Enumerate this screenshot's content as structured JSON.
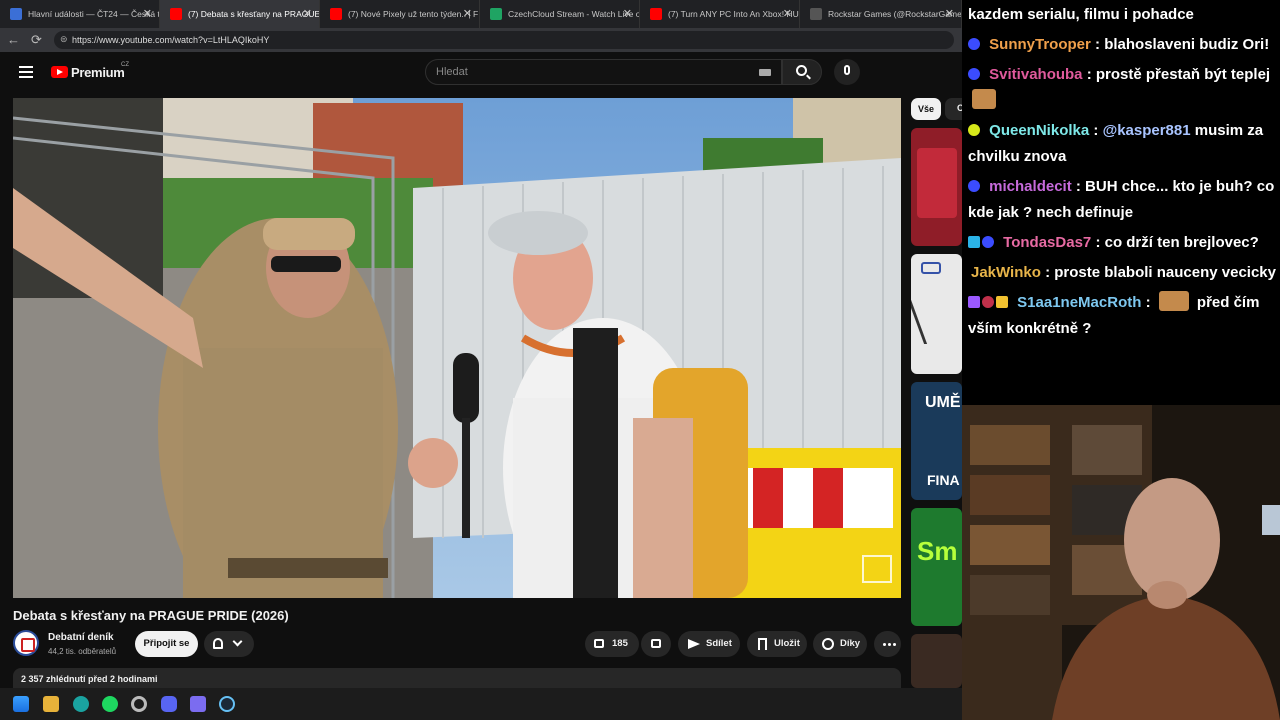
{
  "browser": {
    "tabs": [
      {
        "title": "Hlavní události — ČT24 — Česká t",
        "color": "#3b6fd6",
        "active": false
      },
      {
        "title": "(7) Debata s křesťany na PRAGUE",
        "color": "#ff0000",
        "active": true
      },
      {
        "title": "(7) Nové Pixely už tento týden.. | F",
        "color": "#ff0000",
        "active": false
      },
      {
        "title": "CzechCloud Stream - Watch Live o",
        "color": "#1fa463",
        "active": false
      },
      {
        "title": "(7) Turn ANY PC Into An Xbox! HU",
        "color": "#ff0000",
        "active": false
      },
      {
        "title": "Rockstar Games (@RockstarGame",
        "color": "#555555",
        "active": false
      }
    ],
    "url": "https://www.youtube.com/watch?v=LtHLAQIkoHY"
  },
  "youtube": {
    "logo_text": "Premium",
    "region": "CZ",
    "search_placeholder": "Hledat",
    "video_title": "Debata s křesťany na PRAGUE PRIDE (2026)",
    "channel_name": "Debatní deník",
    "subscribers": "44,2 tis. odběratelů",
    "join_label": "Připojit se",
    "likes": "185",
    "share_label": "Sdílet",
    "save_label": "Uložit",
    "thanks_label": "Díky",
    "views_time": "2 357 zhlédnutí  před 2 hodinami",
    "chip_all": "Vše",
    "chip_other": "O",
    "side_thumb_texts": [
      "UMĚ",
      "FINA",
      "Sm"
    ]
  },
  "chat": {
    "messages": [
      {
        "user": "",
        "color": "#ffffff",
        "badge": "",
        "text": "kazdem serialu, filmu i pohadce"
      },
      {
        "user": "SunnyTrooper",
        "color": "#f0a04b",
        "badge": "#3b4cff",
        "text": ": blahoslaveni budiz Ori!"
      },
      {
        "user": "Svitivahouba",
        "color": "#e05a9c",
        "badge": "#3b4cff",
        "text": ": prostě přestaň být teplej"
      },
      {
        "user": "QueenNikolka",
        "color": "#7ee8e8",
        "badge": "#d6e81a",
        "text": ":",
        "mention": "@kasper881",
        "text2": "musim za chvilku znova"
      },
      {
        "user": "michaldecit",
        "color": "#c66adb",
        "badge": "#3b4cff",
        "text": ": BUH chce... kto je buh? co kde jak ? nech definuje"
      },
      {
        "user": "TondasDas7",
        "color": "#e76aa3",
        "badge": "#2bb4e8",
        "text": ": co drží ten brejlovec?"
      },
      {
        "user": "JakWinko",
        "color": "#e8b54a",
        "badge": "",
        "text": ": proste blaboli nauceny vecicky"
      },
      {
        "user": "S1aa1neMacRoth",
        "color": "#7ec8f0",
        "badge": "#9b59ff",
        "text": ":",
        "text2": "před čím vším konkrétně ?"
      }
    ]
  },
  "colors": {
    "accent": "#ff0000",
    "background": "#0f0f0f",
    "surface": "#272727"
  }
}
